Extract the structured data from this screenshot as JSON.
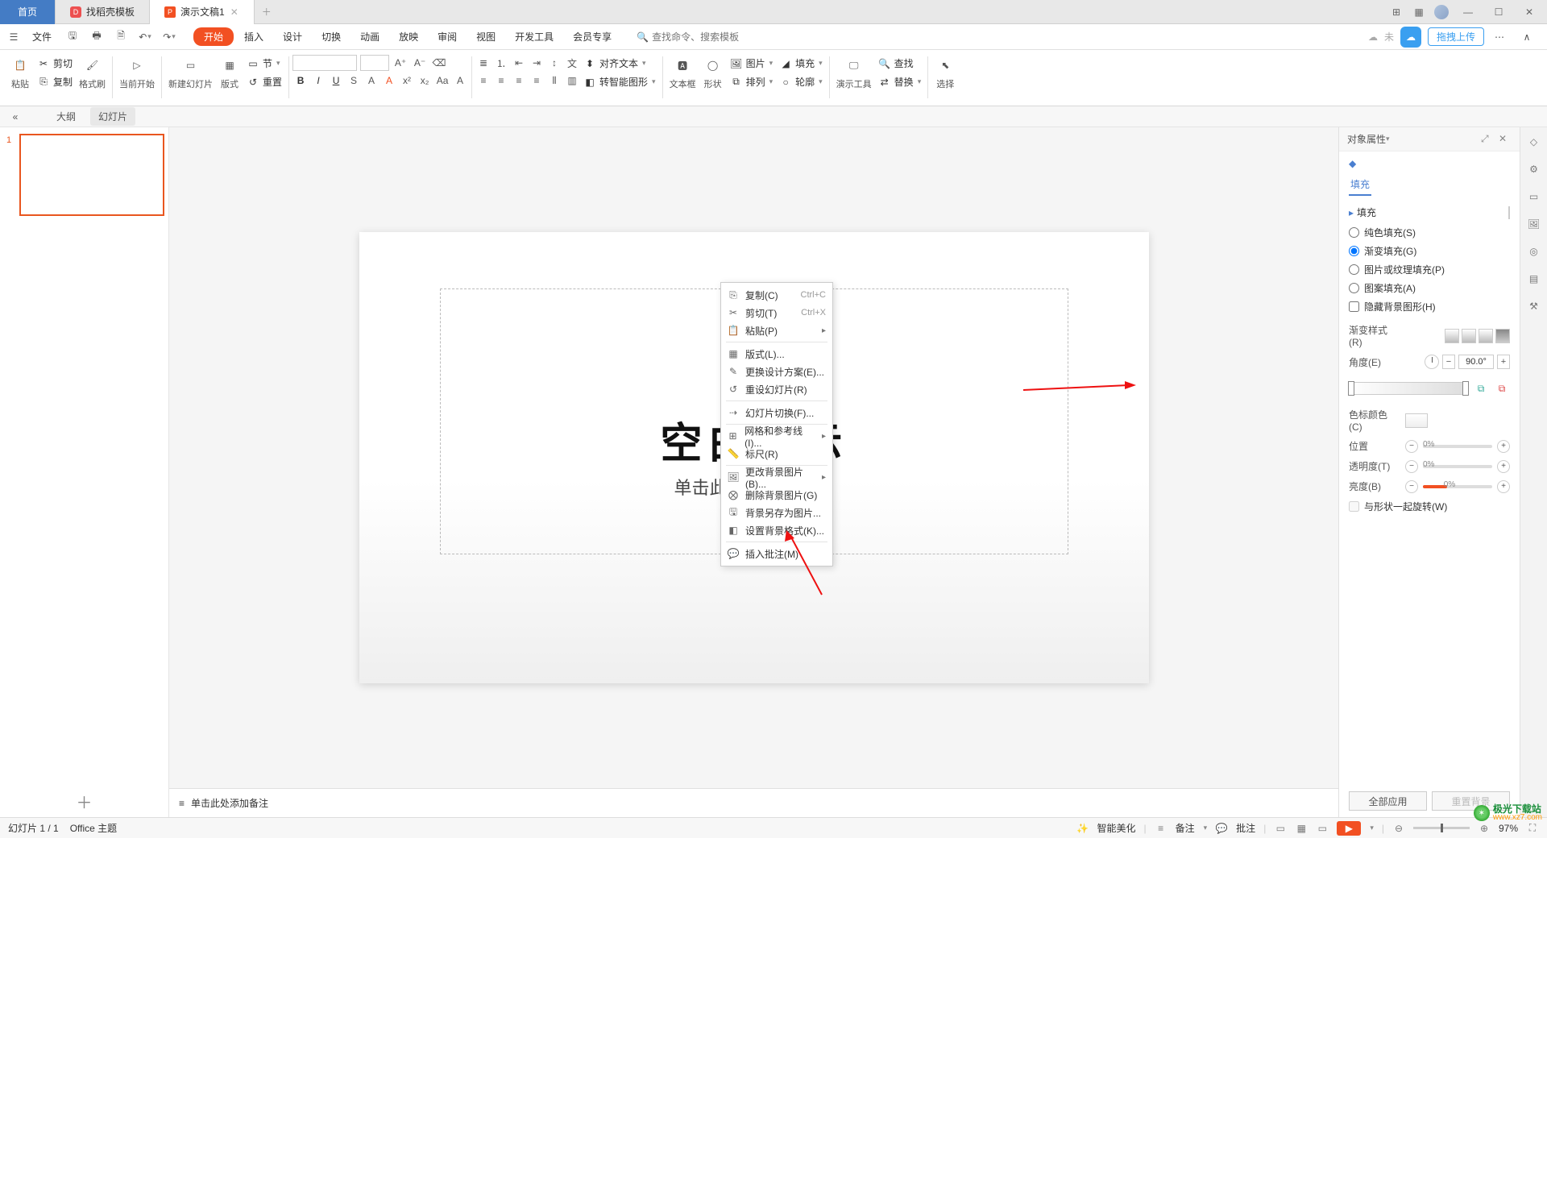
{
  "titlebar": {
    "home": "首页",
    "tabs": [
      {
        "label": "找稻壳模板"
      },
      {
        "label": "演示文稿1"
      }
    ]
  },
  "menubar": {
    "file": "文件",
    "tabs": [
      "开始",
      "插入",
      "设计",
      "切换",
      "动画",
      "放映",
      "审阅",
      "视图",
      "开发工具",
      "会员专享"
    ],
    "search_placeholder": "查找命令、搜索模板",
    "unsync": "未",
    "upload": "拖拽上传"
  },
  "ribbon": {
    "paste": "粘贴",
    "cut": "剪切",
    "copy": "复制",
    "format_painter": "格式刷",
    "from_current": "当前开始",
    "new_slide": "新建幻灯片",
    "layouts": "版式",
    "section": "节",
    "reset": "重置",
    "align_text": "对齐文本",
    "smart_shape": "转智能图形",
    "textbox": "文本框",
    "shapes": "形状",
    "pictures": "图片",
    "arrange": "排列",
    "fill": "填充",
    "outline": "轮廓",
    "presenter": "演示工具",
    "find": "查找",
    "replace": "替换",
    "select": "选择"
  },
  "views": {
    "outline": "大纲",
    "slides": "幻灯片"
  },
  "slide": {
    "num": "1",
    "title": "空白演示",
    "subtitle": "单击此处输入副标题"
  },
  "context": {
    "copy": "复制(C)",
    "copy_sc": "Ctrl+C",
    "cut": "剪切(T)",
    "cut_sc": "Ctrl+X",
    "paste": "粘贴(P)",
    "layout": "版式(L)...",
    "change_design": "更换设计方案(E)...",
    "reset_slide": "重设幻灯片(R)",
    "transition": "幻灯片切换(F)...",
    "grid": "网格和参考线(I)...",
    "ruler": "标尺(R)",
    "change_bg": "更改背景图片(B)...",
    "remove_bg": "删除背景图片(G)",
    "save_bg": "背景另存为图片...",
    "set_bg": "设置背景格式(K)...",
    "insert_comment": "插入批注(M)"
  },
  "notes": "单击此处添加备注",
  "rp": {
    "title": "对象属性",
    "tab": "填充",
    "section": "填充",
    "solid": "纯色填充(S)",
    "gradient": "渐变填充(G)",
    "picture": "图片或纹理填充(P)",
    "pattern": "图案填充(A)",
    "hidebg": "隐藏背景图形(H)",
    "grad_style": "渐变样式(R)",
    "angle": "角度(E)",
    "angle_val": "90.0°",
    "stop_color": "色标颜色(C)",
    "position": "位置",
    "pos_val": "0%",
    "transparency": "透明度(T)",
    "trans_val": "0%",
    "brightness": "亮度(B)",
    "bright_val": "0%",
    "rotate": "与形状一起旋转(W)",
    "apply_all": "全部应用",
    "reset_bg": "重置背景"
  },
  "status": {
    "slide": "幻灯片 1 / 1",
    "theme": "Office 主题",
    "beautify": "智能美化",
    "notes": "备注",
    "comments": "批注",
    "zoom": "97%"
  },
  "watermark": {
    "name": "极光下载站",
    "url": "www.xz7.com"
  }
}
